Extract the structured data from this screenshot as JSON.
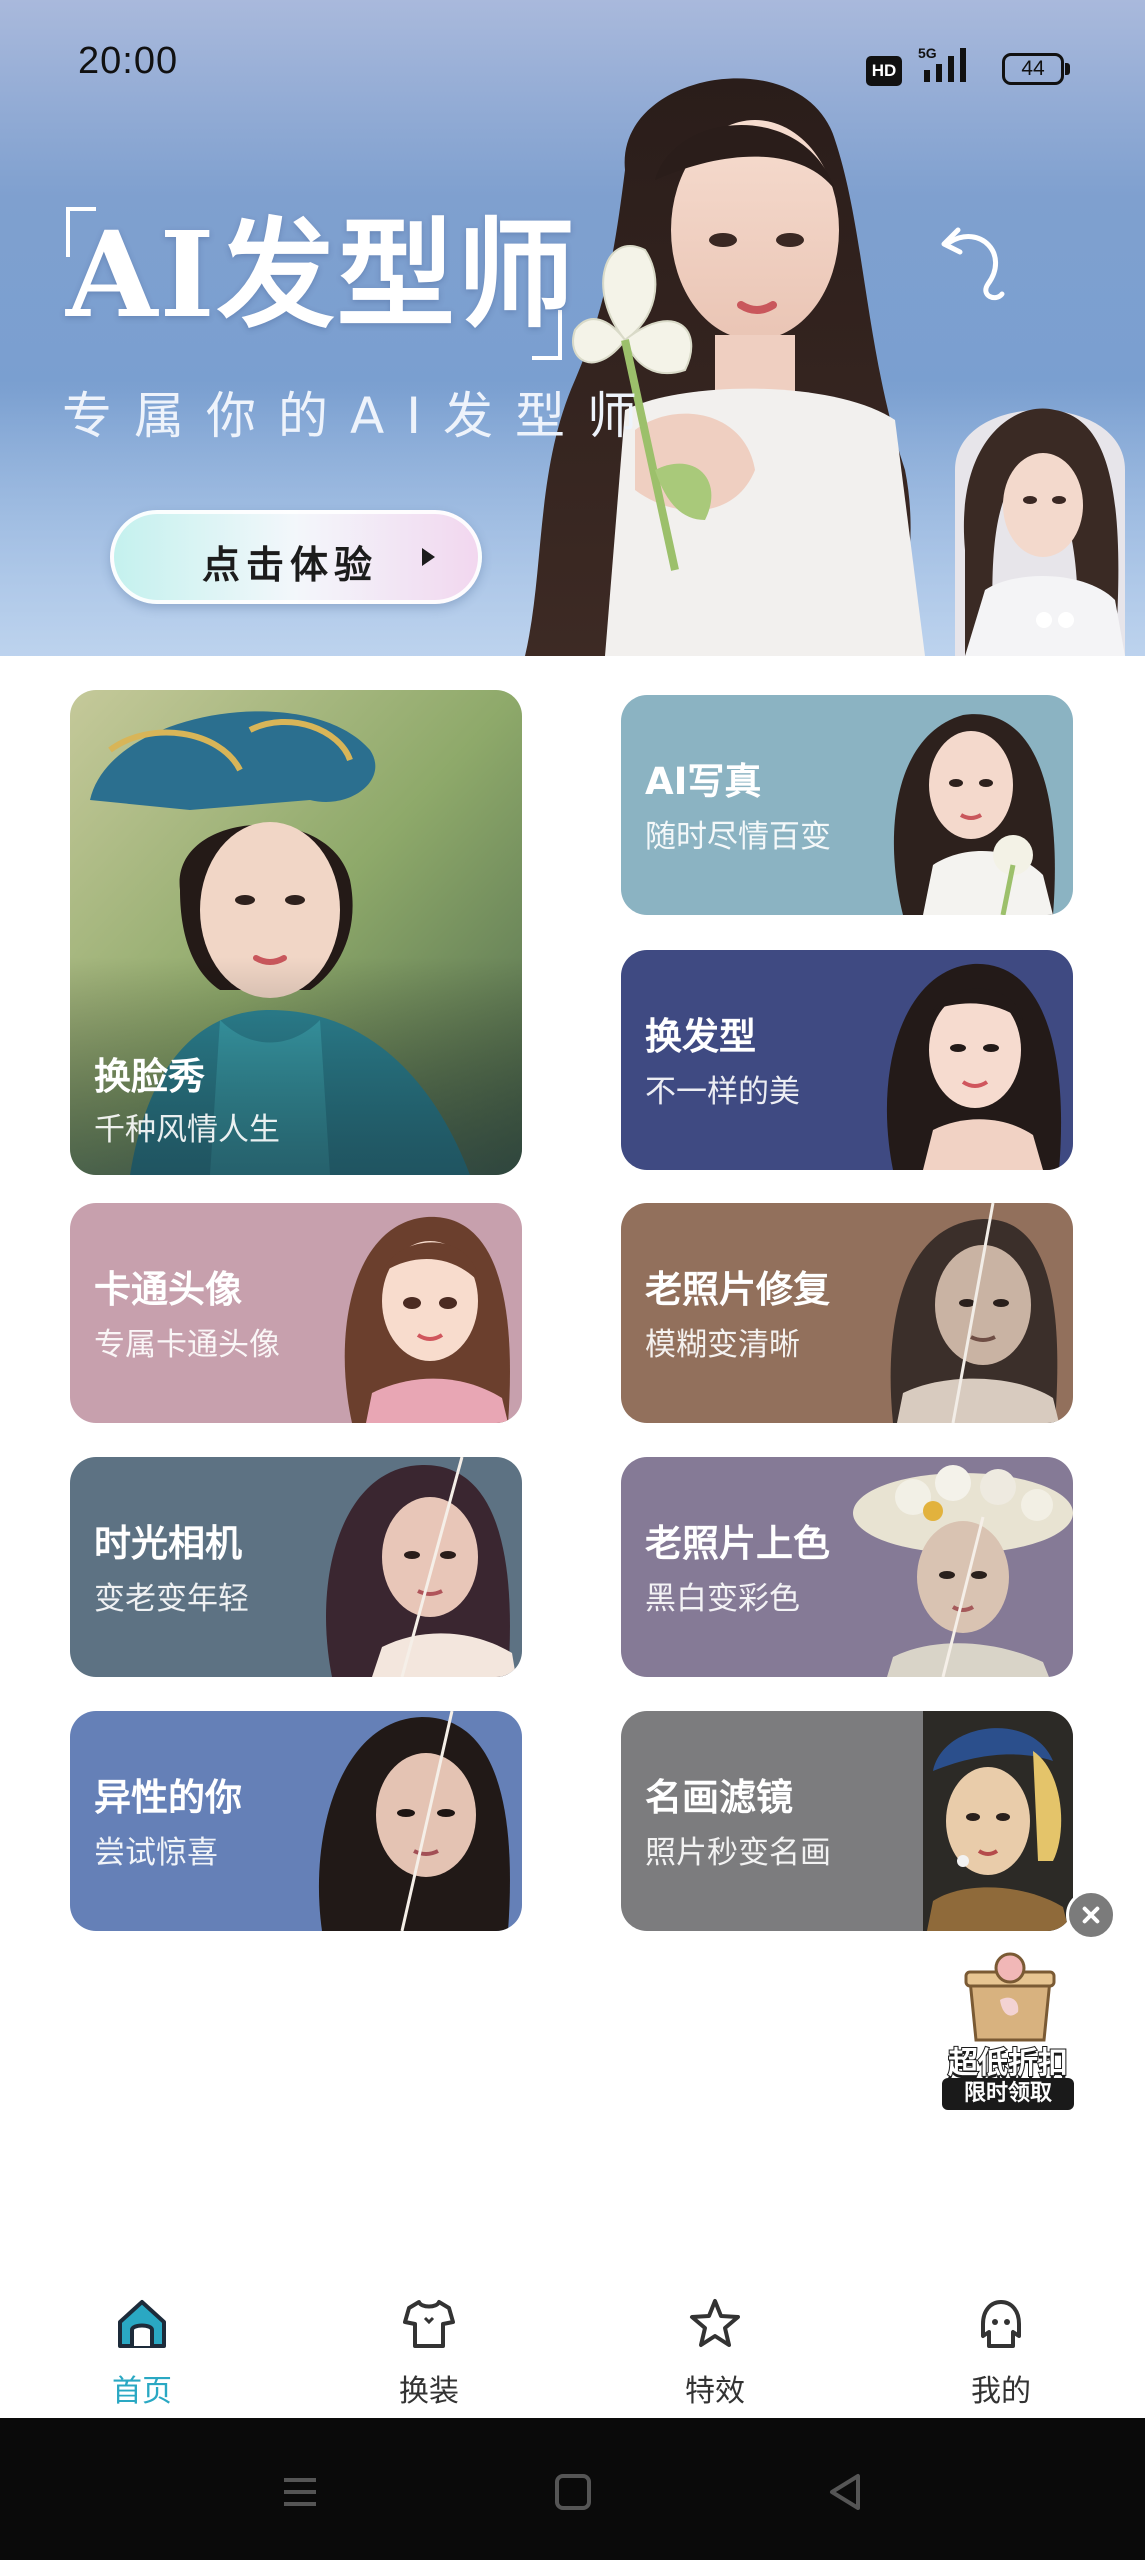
{
  "status_bar": {
    "time": "20:00",
    "hd_badge": "HD",
    "network": "5G",
    "battery": "44"
  },
  "hero": {
    "title": "AI发型师",
    "subtitle": "专属你的AI发型师",
    "cta_label": "点击体验",
    "carousel_dots": 2
  },
  "cards": [
    {
      "title": "换脸秀",
      "subtitle": "千种风情人生",
      "color": "#5b8fa3"
    },
    {
      "title": "AI写真",
      "subtitle": "随时尽情百变",
      "color": "#8bb3c2"
    },
    {
      "title": "换发型",
      "subtitle": "不一样的美",
      "color": "#3f4a82"
    },
    {
      "title": "卡通头像",
      "subtitle": "专属卡通头像",
      "color": "#c7a0ad"
    },
    {
      "title": "老照片修复",
      "subtitle": "模糊变清晰",
      "color": "#92705c"
    },
    {
      "title": "时光相机",
      "subtitle": "变老变年轻",
      "color": "#5d7283"
    },
    {
      "title": "老照片上色",
      "subtitle": "黑白变彩色",
      "color": "#857a96"
    },
    {
      "title": "异性的你",
      "subtitle": "尝试惊喜",
      "color": "#6580b7"
    },
    {
      "title": "名画滤镜",
      "subtitle": "照片秒变名画",
      "color": "#7c7c7e"
    }
  ],
  "promo": {
    "line1": "超低折扣",
    "line2": "限时领取"
  },
  "tabbar": {
    "items": [
      {
        "label": "首页",
        "icon": "home-icon",
        "active": true
      },
      {
        "label": "换装",
        "icon": "shirt-icon",
        "active": false
      },
      {
        "label": "特效",
        "icon": "star-icon",
        "active": false
      },
      {
        "label": "我的",
        "icon": "profile-icon",
        "active": false
      }
    ],
    "active_color": "#2aa8c3"
  },
  "system_nav": {
    "buttons": [
      "menu-icon",
      "home-square-icon",
      "back-icon"
    ]
  }
}
